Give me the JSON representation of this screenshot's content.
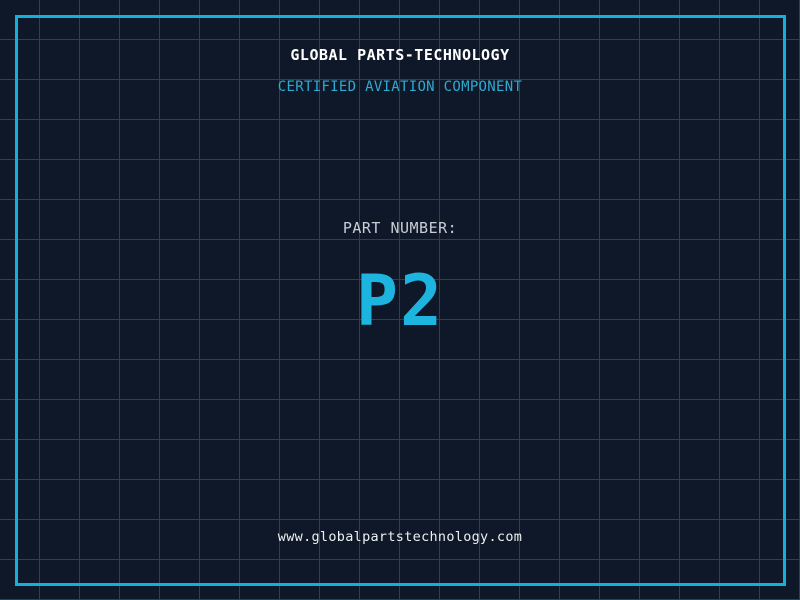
{
  "page": {
    "company_name": "GLOBAL PARTS-TECHNOLOGY",
    "certification_line": "CERTIFIED AVIATION COMPONENT",
    "part_label": "PART NUMBER:",
    "part_number": "P2",
    "website_url": "www.globalpartstechnology.com"
  },
  "colors": {
    "background": "#0f1828",
    "grid_line": "#1a4861",
    "frame_border": "#12b0da",
    "title_text": "#ffffff",
    "certification_text": "#2fa9d1",
    "part_label_text": "#c9cdd6",
    "part_number_text": "#1db5e0",
    "website_text": "#eef0f2"
  }
}
